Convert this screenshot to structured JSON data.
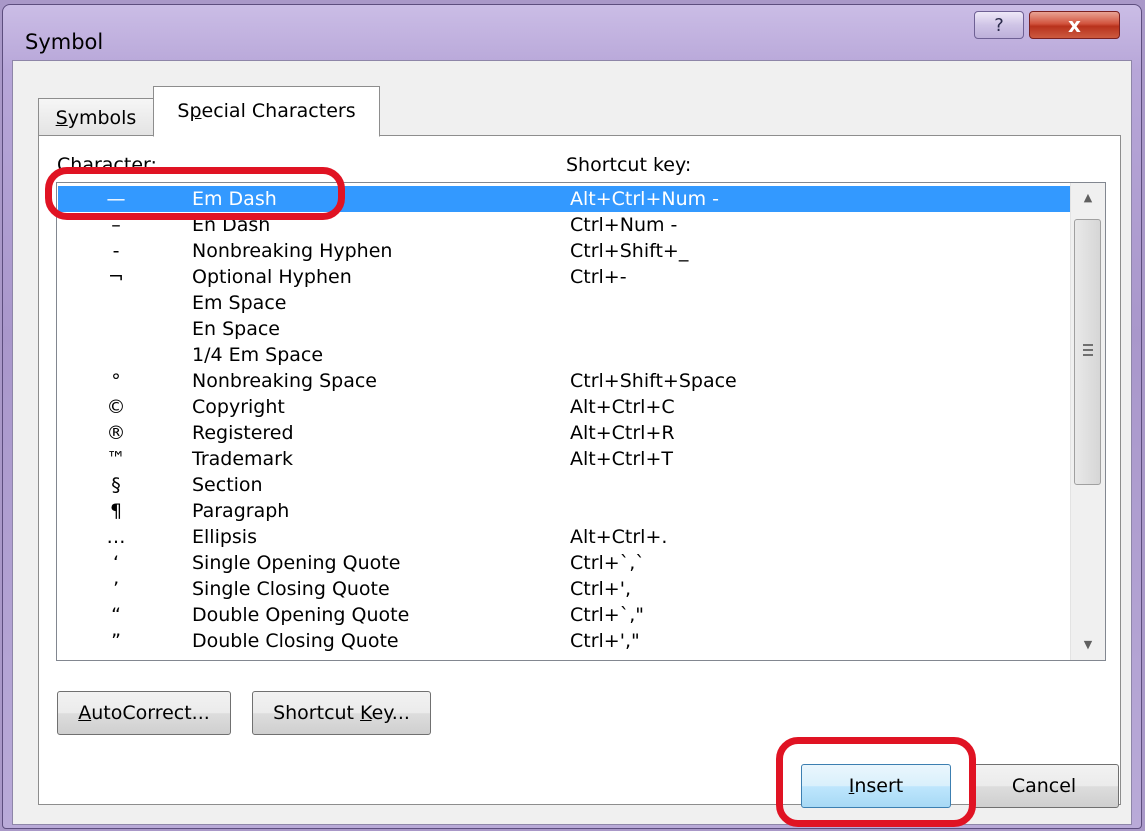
{
  "window": {
    "title": "Symbol",
    "help_label": "?",
    "close_label": "x"
  },
  "tabs": [
    {
      "label_pre": "",
      "label_u": "S",
      "label_post": "ymbols"
    },
    {
      "label_pre": "S",
      "label_u": "p",
      "label_post": "ecial Characters"
    }
  ],
  "list": {
    "col_character_pre": "C",
    "col_character_u": "h",
    "col_character_post": "aracter:",
    "col_shortcut": "Shortcut key:",
    "rows": [
      {
        "char": "—",
        "name": "Em Dash",
        "shortcut": "Alt+Ctrl+Num -",
        "selected": true
      },
      {
        "char": "–",
        "name": "En Dash",
        "shortcut": "Ctrl+Num -"
      },
      {
        "char": "-",
        "name": "Nonbreaking Hyphen",
        "shortcut": "Ctrl+Shift+_"
      },
      {
        "char": "¬",
        "name": "Optional Hyphen",
        "shortcut": "Ctrl+-"
      },
      {
        "char": "",
        "name": "Em Space",
        "shortcut": ""
      },
      {
        "char": "",
        "name": "En Space",
        "shortcut": ""
      },
      {
        "char": "",
        "name": "1/4 Em Space",
        "shortcut": ""
      },
      {
        "char": "°",
        "name": "Nonbreaking Space",
        "shortcut": "Ctrl+Shift+Space"
      },
      {
        "char": "©",
        "name": "Copyright",
        "shortcut": "Alt+Ctrl+C"
      },
      {
        "char": "®",
        "name": "Registered",
        "shortcut": "Alt+Ctrl+R"
      },
      {
        "char": "™",
        "name": "Trademark",
        "shortcut": "Alt+Ctrl+T"
      },
      {
        "char": "§",
        "name": "Section",
        "shortcut": ""
      },
      {
        "char": "¶",
        "name": "Paragraph",
        "shortcut": ""
      },
      {
        "char": "…",
        "name": "Ellipsis",
        "shortcut": "Alt+Ctrl+."
      },
      {
        "char": "‘",
        "name": "Single Opening Quote",
        "shortcut": "Ctrl+`,`"
      },
      {
        "char": "’",
        "name": "Single Closing Quote",
        "shortcut": "Ctrl+',"
      },
      {
        "char": "“",
        "name": "Double Opening Quote",
        "shortcut": "Ctrl+`,\""
      },
      {
        "char": "”",
        "name": "Double Closing Quote",
        "shortcut": "Ctrl+',\""
      }
    ]
  },
  "buttons": {
    "autocorrect_u": "A",
    "autocorrect_post": "utoCorrect...",
    "shortcut_pre": "Shortcut ",
    "shortcut_u": "K",
    "shortcut_post": "ey...",
    "insert_u": "I",
    "insert_post": "nsert",
    "cancel": "Cancel"
  },
  "colors": {
    "selection": "#3399ff",
    "highlight": "#e01323"
  }
}
